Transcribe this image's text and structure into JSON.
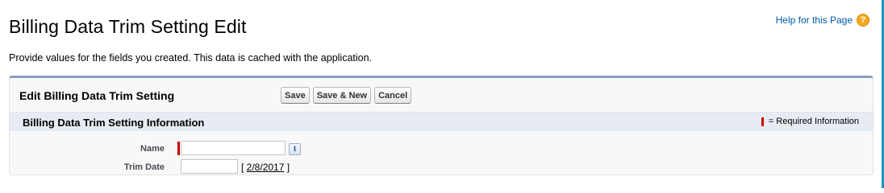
{
  "page": {
    "title": "Billing Data Trim Setting Edit",
    "help_link": "Help for this Page",
    "help_icon": "question-circle-icon",
    "description": "Provide values for the fields you created. This data is cached with the application."
  },
  "panel": {
    "title": "Edit Billing Data Trim Setting",
    "buttons": {
      "save": "Save",
      "save_new": "Save & New",
      "cancel": "Cancel"
    },
    "section": {
      "title": "Billing Data Trim Setting Information",
      "required_legend": "= Required Information"
    },
    "fields": {
      "name": {
        "label": "Name",
        "value": "",
        "required": true,
        "info_icon": "info-icon"
      },
      "trim_date": {
        "label": "Trim Date",
        "value": "",
        "date_prefix": "[ ",
        "date_link": "2/8/2017",
        "date_suffix": " ]"
      }
    }
  },
  "colors": {
    "accent": "#1798c1",
    "panel_border": "#8a9ebe",
    "required": "#cc0000",
    "section_bg": "#e7ecf3"
  }
}
